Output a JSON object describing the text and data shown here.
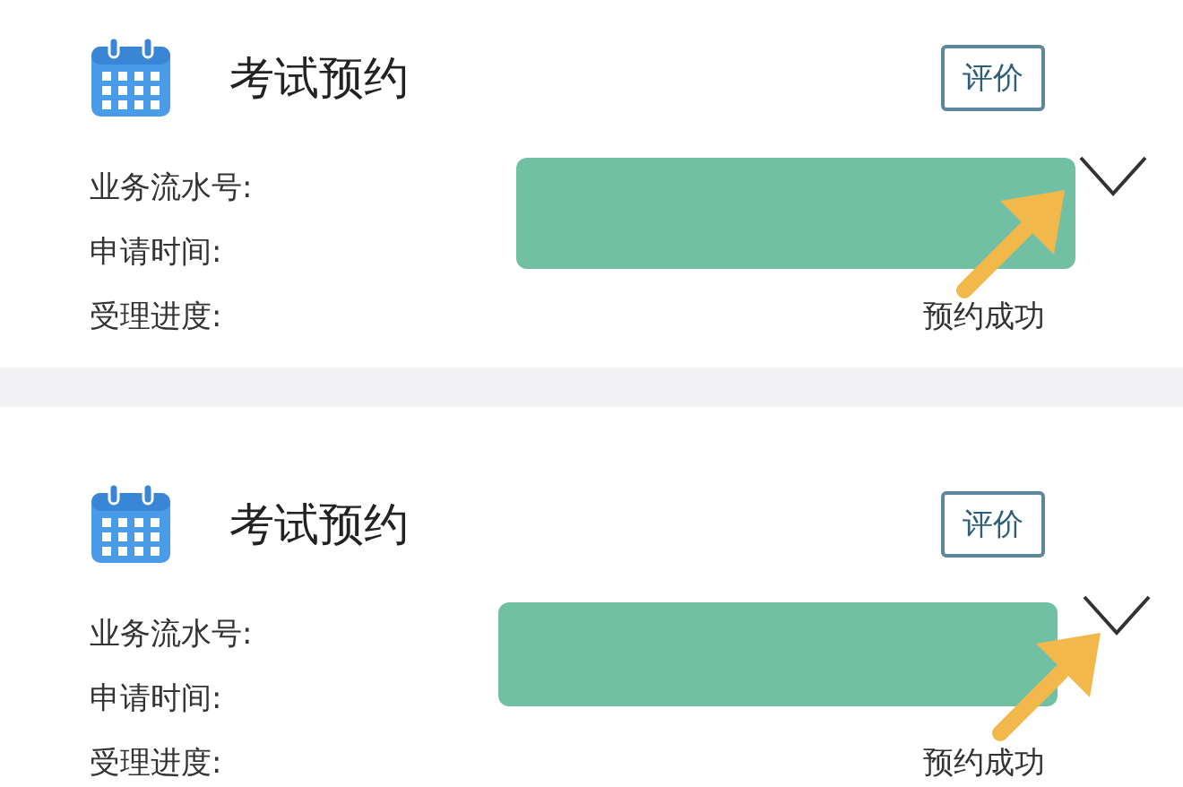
{
  "records": [
    {
      "title": "考试预约",
      "button": "评价",
      "fields": [
        {
          "label": "业务流水号:"
        },
        {
          "label": "申请时间:"
        },
        {
          "label": "受理进度:",
          "value": "预约成功"
        }
      ]
    },
    {
      "title": "考试预约",
      "button": "评价",
      "fields": [
        {
          "label": "业务流水号:"
        },
        {
          "label": "申请时间:"
        },
        {
          "label": "受理进度:",
          "value": "预约成功"
        }
      ]
    }
  ]
}
